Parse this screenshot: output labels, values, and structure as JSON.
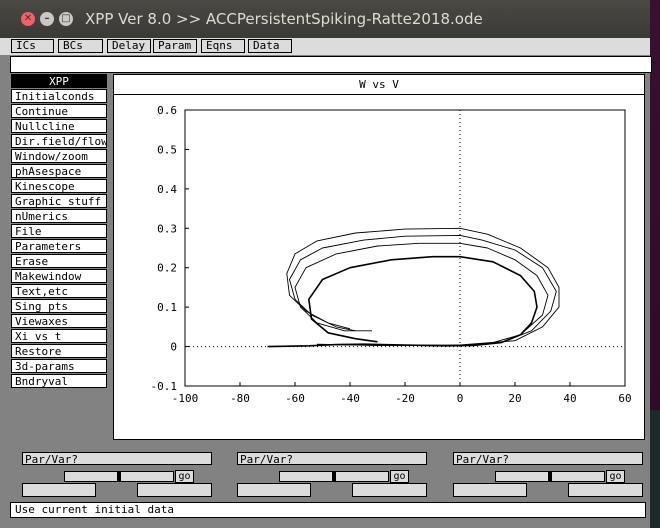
{
  "window": {
    "title": "XPP Ver 8.0 >> ACCPersistentSpiking-Ratte2018.ode"
  },
  "top_buttons": [
    "ICs",
    "BCs",
    "Delay",
    "Param",
    "Eqns",
    "Data"
  ],
  "side_menu": [
    "XPP",
    "Initialconds",
    "Continue",
    "Nullcline",
    "Dir.field/flow",
    "Window/zoom",
    "phAsespace",
    "Kinescope",
    "Graphic stuff",
    "nUmerics",
    "File",
    "Parameters",
    "Erase",
    "Makewindow",
    "Text,etc",
    "Sing pts",
    "Viewaxes",
    "Xi vs t",
    "Restore",
    "3d-params",
    "Bndryval"
  ],
  "graph": {
    "title": "W vs V",
    "x_ticks": [
      "-100",
      "-80",
      "-60",
      "-40",
      "-20",
      "0",
      "20",
      "40",
      "60"
    ],
    "y_ticks": [
      "0.6",
      "0.5",
      "0.4",
      "0.3",
      "0.2",
      "0.1",
      "0",
      "-0.1"
    ]
  },
  "chart_data": {
    "type": "line",
    "title": "W vs V",
    "xlim": [
      -100,
      60
    ],
    "ylim": [
      -0.1,
      0.6
    ],
    "grid": false,
    "zero_axes_dotted": true,
    "series": [
      {
        "values_xy": [
          [
            -70,
            0
          ],
          [
            -55,
            0.002
          ],
          [
            -45,
            0.005
          ],
          [
            -35,
            0.006
          ],
          [
            -20,
            0.004
          ],
          [
            -5,
            0.002
          ],
          [
            5,
            0.003
          ],
          [
            15,
            0.01
          ],
          [
            22,
            0.03
          ],
          [
            26,
            0.06
          ],
          [
            28,
            0.1
          ],
          [
            27,
            0.14
          ],
          [
            22,
            0.18
          ],
          [
            12,
            0.215
          ],
          [
            0,
            0.228
          ],
          [
            -10,
            0.228
          ],
          [
            -25,
            0.22
          ],
          [
            -40,
            0.2
          ],
          [
            -50,
            0.17
          ],
          [
            -55,
            0.12
          ],
          [
            -54,
            0.07
          ],
          [
            -48,
            0.035
          ],
          [
            -38,
            0.02
          ],
          [
            -30,
            0.012
          ]
        ]
      },
      {
        "values_xy": [
          [
            -45,
            0.005
          ],
          [
            -30,
            0.004
          ],
          [
            -10,
            0.002
          ],
          [
            10,
            0.006
          ],
          [
            22,
            0.03
          ],
          [
            30,
            0.08
          ],
          [
            32,
            0.13
          ],
          [
            28,
            0.18
          ],
          [
            20,
            0.22
          ],
          [
            10,
            0.25
          ],
          [
            0,
            0.262
          ],
          [
            -15,
            0.262
          ],
          [
            -30,
            0.255
          ],
          [
            -45,
            0.235
          ],
          [
            -56,
            0.2
          ],
          [
            -60,
            0.15
          ],
          [
            -58,
            0.1
          ],
          [
            -52,
            0.06
          ],
          [
            -42,
            0.04
          ],
          [
            -32,
            0.04
          ]
        ]
      },
      {
        "values_xy": [
          [
            -48,
            0.005
          ],
          [
            -30,
            0.003
          ],
          [
            0,
            0.003
          ],
          [
            15,
            0.01
          ],
          [
            26,
            0.04
          ],
          [
            33,
            0.09
          ],
          [
            35,
            0.14
          ],
          [
            30,
            0.2
          ],
          [
            20,
            0.245
          ],
          [
            8,
            0.27
          ],
          [
            0,
            0.282
          ],
          [
            -20,
            0.28
          ],
          [
            -35,
            0.27
          ],
          [
            -50,
            0.25
          ],
          [
            -58,
            0.22
          ],
          [
            -62,
            0.17
          ],
          [
            -60,
            0.12
          ],
          [
            -54,
            0.08
          ],
          [
            -45,
            0.05
          ],
          [
            -38,
            0.04
          ]
        ]
      },
      {
        "values_xy": [
          [
            -52,
            0.006
          ],
          [
            -30,
            0.003
          ],
          [
            0,
            0.004
          ],
          [
            20,
            0.015
          ],
          [
            30,
            0.05
          ],
          [
            36,
            0.1
          ],
          [
            36,
            0.15
          ],
          [
            32,
            0.2
          ],
          [
            22,
            0.25
          ],
          [
            10,
            0.285
          ],
          [
            0,
            0.3
          ],
          [
            -20,
            0.298
          ],
          [
            -38,
            0.288
          ],
          [
            -52,
            0.268
          ],
          [
            -60,
            0.235
          ],
          [
            -63,
            0.185
          ],
          [
            -62,
            0.13
          ],
          [
            -56,
            0.09
          ],
          [
            -48,
            0.06
          ],
          [
            -40,
            0.045
          ]
        ]
      }
    ]
  },
  "par_panels": [
    {
      "label": "Par/Var?",
      "go": "go"
    },
    {
      "label": "Par/Var?",
      "go": "go"
    },
    {
      "label": "Par/Var?",
      "go": "go"
    }
  ],
  "status": "Use current initial data",
  "colors": {
    "window_bg": "#828282",
    "panel_bg": "#dcdcdc",
    "titlebar": "#3c3b37",
    "close_button": "#f46067"
  }
}
